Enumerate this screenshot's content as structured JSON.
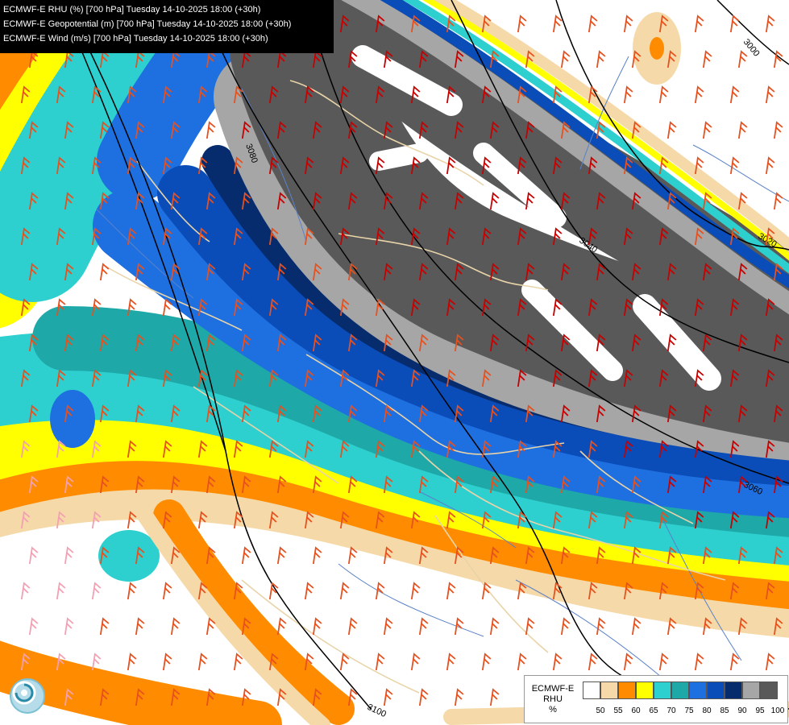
{
  "header": {
    "line1": "ECMWF-E RHU (%) [700 hPa] Tuesday 14-10-2025 18:00 (+30h)",
    "line2": "ECMWF-E Geopotential (m) [700 hPa] Tuesday 14-10-2025 18:00 (+30h)",
    "line3": "ECMWF-E Wind (m/s) [700 hPa] Tuesday 14-10-2025 18:00 (+30h)"
  },
  "contour_labels": [
    "3000",
    "3020",
    "3040",
    "3060",
    "3080",
    "3100",
    "3080",
    "3060"
  ],
  "legend": {
    "title_line1": "ECMWF-E",
    "title_line2": "RHU",
    "title_line3": "%",
    "classes": [
      {
        "color": "#ffffff"
      },
      {
        "color": "#f5d9a8"
      },
      {
        "color": "#ff8c00"
      },
      {
        "color": "#ffff00"
      },
      {
        "color": "#2ecfcf"
      },
      {
        "color": "#1fa8a8"
      },
      {
        "color": "#1e6fe0"
      },
      {
        "color": "#0a4cb8"
      },
      {
        "color": "#062c6e"
      },
      {
        "color": "#a6a6a6"
      },
      {
        "color": "#595959"
      }
    ],
    "ticks": [
      "50",
      "55",
      "60",
      "65",
      "70",
      "75",
      "80",
      "85",
      "90",
      "95",
      "100"
    ]
  },
  "colors": {
    "barb_dark": "#c80000",
    "barb_mid": "#e8501e",
    "barb_light": "#f4a0b4",
    "border": "#e8d4a8",
    "river": "#5a82c8"
  }
}
